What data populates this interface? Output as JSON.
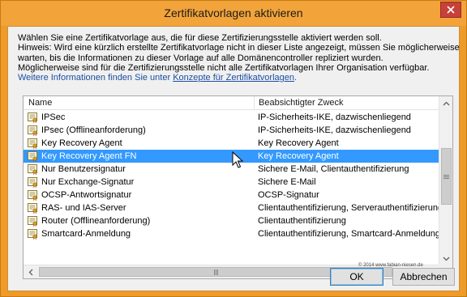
{
  "window": {
    "title": "Zertifikatvorlagen aktivieren"
  },
  "description": {
    "lines": [
      "Wählen Sie eine Zertifikatvorlage aus, die für diese Zertifizierungsstelle aktiviert werden soll.",
      "Hinweis: Wird eine kürzlich erstellte Zertifikatvorlage nicht in dieser Liste angezeigt, müssen Sie möglicherweise",
      "warten, bis die Informationen zu dieser Vorlage auf alle Domänencontroller repliziert wurden.",
      "Möglicherweise sind für die Zertifizierungsstelle nicht alle Zertifikatvorlagen Ihrer Organisation verfügbar."
    ],
    "info_prefix": "Weitere Informationen finden Sie unter ",
    "info_link": "Konzepte für Zertifikatvorlagen",
    "info_suffix": "."
  },
  "table": {
    "columns": [
      "Name",
      "Beabsichtigter Zweck"
    ],
    "rows": [
      {
        "name": "IPSec",
        "purpose": "IP-Sicherheits-IKE, dazwischenliegend",
        "selected": false
      },
      {
        "name": "IPsec (Offlineanforderung)",
        "purpose": "IP-Sicherheits-IKE, dazwischenliegend",
        "selected": false
      },
      {
        "name": "Key Recovery Agent",
        "purpose": "Key Recovery Agent",
        "selected": false
      },
      {
        "name": "Key Recovery Agent FN",
        "purpose": "Key Recovery Agent",
        "selected": true
      },
      {
        "name": "Nur Benutzersignatur",
        "purpose": "Sichere E-Mail, Clientauthentifizierung",
        "selected": false
      },
      {
        "name": "Nur Exchange-Signatur",
        "purpose": "Sichere E-Mail",
        "selected": false
      },
      {
        "name": "OCSP-Antwortsignatur",
        "purpose": "OCSP-Signatur",
        "selected": false
      },
      {
        "name": "RAS- und IAS-Server",
        "purpose": "Clientauthentifizierung, Serverauthentifizierung",
        "selected": false
      },
      {
        "name": "Router (Offlineanforderung)",
        "purpose": "Clientauthentifizierung",
        "selected": false
      },
      {
        "name": "Smartcard-Anmeldung",
        "purpose": "Clientauthentifizierung, Smartcard-Anmeldung",
        "selected": false
      }
    ]
  },
  "watermark": "© 2014 www.fabian-niesen.de",
  "buttons": {
    "ok": "OK",
    "cancel": "Abbrechen"
  },
  "icons": {
    "row_icon": "certificate-template-icon",
    "close": "close-icon",
    "cursor": "mouse-pointer-icon"
  },
  "colors": {
    "title_bar": "#f2a33a",
    "selection": "#3399ff",
    "close_button": "#c7403a",
    "link": "#1a4fa3"
  }
}
